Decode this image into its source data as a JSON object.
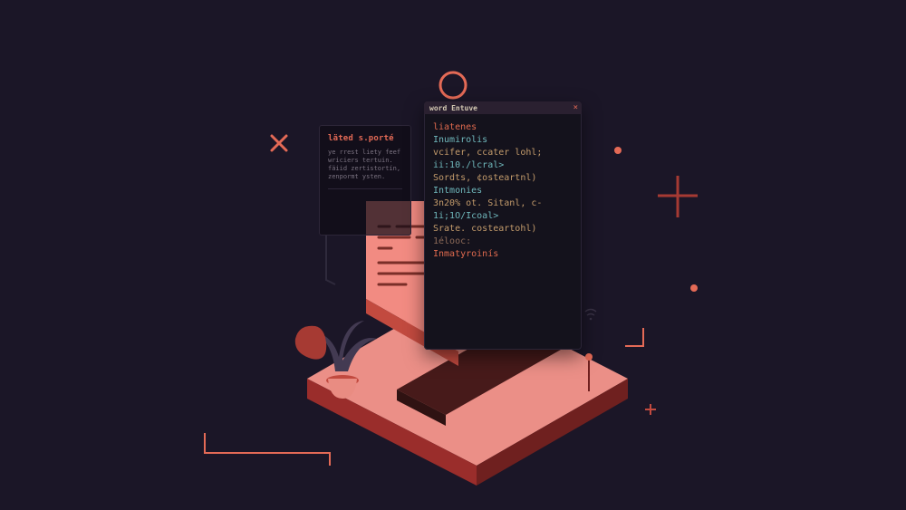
{
  "colors": {
    "bg": "#1b1627",
    "accent": "#e46a56",
    "panel": "#14121c",
    "platform_top": "#eb8f87",
    "platform_front": "#9a2d2b",
    "platform_side": "#6f201f",
    "paper_light": "#f28b82",
    "paper_dark": "#c24a3f",
    "teal": "#6fb7bb",
    "tan": "#c39b6b"
  },
  "side_panel": {
    "title": "läted s.porté",
    "body": "ye rrest liety feef\nwriciers tertuin.\nfäiid zertistortín,\nzenpormt ysten."
  },
  "terminal": {
    "title": "word Entuve",
    "close_glyph": "×",
    "lines": [
      {
        "cls": "c-orange",
        "text": "liatenes"
      },
      {
        "cls": "c-teal",
        "text": "Inumirolis"
      },
      {
        "cls": "c-tan",
        "text": "vcifer, ccater lohl;"
      },
      {
        "cls": "c-teal",
        "text": "ii:10./lcral>"
      },
      {
        "cls": "c-tan",
        "text": "Sordts, ¢osteartnl)"
      },
      {
        "cls": "",
        "text": ""
      },
      {
        "cls": "c-teal",
        "text": "Intmonies"
      },
      {
        "cls": "c-tan",
        "text": "3n20% ot. Sitanl, c-"
      },
      {
        "cls": "c-teal",
        "text": "1i;1O/Icoal>"
      },
      {
        "cls": "c-tan",
        "text": "Srate. costeartohl)"
      },
      {
        "cls": "",
        "text": ""
      },
      {
        "cls": "c-dim",
        "text": "1élooc:"
      },
      {
        "cls": "c-orange",
        "text": "Inmatyroinís"
      }
    ]
  }
}
